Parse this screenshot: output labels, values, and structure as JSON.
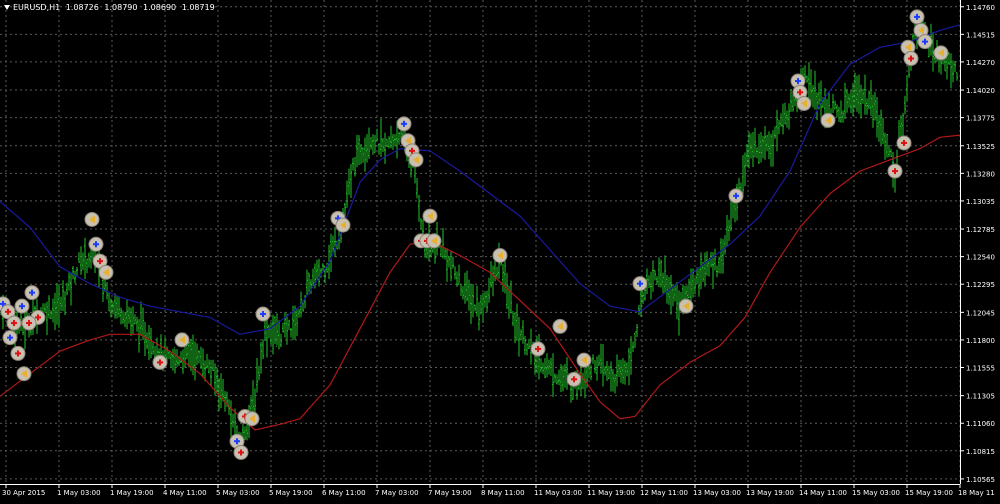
{
  "header": {
    "symbol": "EURUSD,H1",
    "open": "1.08726",
    "high": "1.08790",
    "low": "1.08690",
    "close": "1.08719"
  },
  "colors": {
    "background": "#000000",
    "grid": "#5a5a5a",
    "candle": "#22c32a",
    "ma_fast": "#1a1a9e",
    "ma_slow": "#b01818",
    "axis_text": "#ffffff",
    "signal_buy": "#1a3cff",
    "signal_sell": "#e01010",
    "signal_neutral": "#e8b030"
  },
  "chart_data": {
    "type": "line",
    "price_axis": {
      "ticks": [
        "1.14760",
        "1.14515",
        "1.14270",
        "1.14020",
        "1.13775",
        "1.13525",
        "1.13280",
        "1.13035",
        "1.12785",
        "1.12540",
        "1.12295",
        "1.12045",
        "1.11800",
        "1.11555",
        "1.11305",
        "1.11060",
        "1.10815",
        "1.10565"
      ],
      "ylim": [
        1.1052,
        1.1482
      ]
    },
    "time_axis": {
      "ticks": [
        "30 Apr 2015",
        "1 May 03:00",
        "1 May 19:00",
        "4 May 11:00",
        "5 May 03:00",
        "5 May 19:00",
        "6 May 11:00",
        "7 May 03:00",
        "7 May 19:00",
        "8 May 11:00",
        "11 May 03:00",
        "11 May 19:00",
        "12 May 11:00",
        "13 May 03:00",
        "13 May 19:00",
        "14 May 11:00",
        "15 May 03:00",
        "15 May 19:00",
        "18 May 11"
      ]
    },
    "grid": true,
    "price_path": [
      [
        0,
        1.1212
      ],
      [
        20,
        1.119
      ],
      [
        40,
        1.1205
      ],
      [
        60,
        1.121
      ],
      [
        80,
        1.125
      ],
      [
        95,
        1.1255
      ],
      [
        110,
        1.1215
      ],
      [
        130,
        1.12
      ],
      [
        150,
        1.118
      ],
      [
        170,
        1.116
      ],
      [
        190,
        1.117
      ],
      [
        210,
        1.1155
      ],
      [
        225,
        1.113
      ],
      [
        240,
        1.1085
      ],
      [
        255,
        1.113
      ],
      [
        265,
        1.119
      ],
      [
        280,
        1.1185
      ],
      [
        295,
        1.1195
      ],
      [
        310,
        1.123
      ],
      [
        325,
        1.1245
      ],
      [
        340,
        1.1275
      ],
      [
        355,
        1.134
      ],
      [
        370,
        1.136
      ],
      [
        385,
        1.135
      ],
      [
        400,
        1.1365
      ],
      [
        415,
        1.133
      ],
      [
        425,
        1.126
      ],
      [
        440,
        1.1265
      ],
      [
        460,
        1.123
      ],
      [
        480,
        1.1205
      ],
      [
        500,
        1.125
      ],
      [
        515,
        1.1195
      ],
      [
        535,
        1.1165
      ],
      [
        555,
        1.115
      ],
      [
        575,
        1.114
      ],
      [
        595,
        1.116
      ],
      [
        615,
        1.1145
      ],
      [
        630,
        1.116
      ],
      [
        645,
        1.123
      ],
      [
        660,
        1.124
      ],
      [
        680,
        1.121
      ],
      [
        700,
        1.124
      ],
      [
        720,
        1.125
      ],
      [
        735,
        1.13
      ],
      [
        750,
        1.135
      ],
      [
        770,
        1.1355
      ],
      [
        790,
        1.1385
      ],
      [
        805,
        1.142
      ],
      [
        820,
        1.139
      ],
      [
        840,
        1.138
      ],
      [
        855,
        1.14
      ],
      [
        870,
        1.139
      ],
      [
        885,
        1.136
      ],
      [
        895,
        1.133
      ],
      [
        905,
        1.139
      ],
      [
        915,
        1.146
      ],
      [
        925,
        1.145
      ],
      [
        940,
        1.143
      ],
      [
        955,
        1.142
      ]
    ],
    "series": [
      {
        "values": [
          [
            0,
            1.1303
          ],
          [
            30,
            1.128
          ],
          [
            60,
            1.1245
          ],
          [
            90,
            1.123
          ],
          [
            120,
            1.1218
          ],
          [
            150,
            1.121
          ],
          [
            180,
            1.1205
          ],
          [
            210,
            1.12
          ],
          [
            240,
            1.1185
          ],
          [
            270,
            1.119
          ],
          [
            300,
            1.121
          ],
          [
            330,
            1.125
          ],
          [
            360,
            1.132
          ],
          [
            380,
            1.134
          ],
          [
            400,
            1.135
          ],
          [
            430,
            1.1348
          ],
          [
            460,
            1.133
          ],
          [
            490,
            1.131
          ],
          [
            520,
            1.129
          ],
          [
            550,
            1.126
          ],
          [
            580,
            1.123
          ],
          [
            610,
            1.121
          ],
          [
            640,
            1.1205
          ],
          [
            670,
            1.1225
          ],
          [
            700,
            1.1245
          ],
          [
            730,
            1.1265
          ],
          [
            760,
            1.129
          ],
          [
            790,
            1.133
          ],
          [
            820,
            1.139
          ],
          [
            850,
            1.1425
          ],
          [
            880,
            1.144
          ],
          [
            910,
            1.1445
          ],
          [
            940,
            1.1455
          ],
          [
            960,
            1.146
          ]
        ]
      },
      {
        "values": [
          [
            0,
            1.113
          ],
          [
            30,
            1.115
          ],
          [
            60,
            1.117
          ],
          [
            90,
            1.118
          ],
          [
            110,
            1.1185
          ],
          [
            140,
            1.1185
          ],
          [
            170,
            1.117
          ],
          [
            200,
            1.115
          ],
          [
            230,
            1.112
          ],
          [
            255,
            1.11
          ],
          [
            280,
            1.1105
          ],
          [
            300,
            1.111
          ],
          [
            330,
            1.114
          ],
          [
            360,
            1.119
          ],
          [
            390,
            1.124
          ],
          [
            410,
            1.1265
          ],
          [
            430,
            1.1268
          ],
          [
            460,
            1.1255
          ],
          [
            490,
            1.124
          ],
          [
            520,
            1.1215
          ],
          [
            550,
            1.119
          ],
          [
            580,
            1.115
          ],
          [
            600,
            1.1125
          ],
          [
            620,
            1.111
          ],
          [
            635,
            1.1112
          ],
          [
            660,
            1.114
          ],
          [
            690,
            1.116
          ],
          [
            720,
            1.1175
          ],
          [
            745,
            1.12
          ],
          [
            770,
            1.124
          ],
          [
            800,
            1.128
          ],
          [
            830,
            1.131
          ],
          [
            860,
            1.133
          ],
          [
            890,
            1.134
          ],
          [
            920,
            1.135
          ],
          [
            940,
            1.136
          ],
          [
            960,
            1.1362
          ]
        ]
      }
    ],
    "signals": [
      [
        3,
        1.1212,
        "buy"
      ],
      [
        8,
        1.1205,
        "sell"
      ],
      [
        14,
        1.1195,
        "sell"
      ],
      [
        22,
        1.121,
        "buy"
      ],
      [
        32,
        1.1222,
        "buy"
      ],
      [
        38,
        1.12,
        "sell"
      ],
      [
        10,
        1.1182,
        "buy"
      ],
      [
        18,
        1.1168,
        "sell"
      ],
      [
        24,
        1.115,
        "neutral"
      ],
      [
        29,
        1.1195,
        "sell"
      ],
      [
        92,
        1.1287,
        "neutral"
      ],
      [
        96,
        1.1265,
        "buy"
      ],
      [
        100,
        1.125,
        "sell"
      ],
      [
        106,
        1.124,
        "neutral"
      ],
      [
        160,
        1.116,
        "sell"
      ],
      [
        182,
        1.118,
        "neutral"
      ],
      [
        237,
        1.109,
        "buy"
      ],
      [
        241,
        1.108,
        "sell"
      ],
      [
        245,
        1.1112,
        "sell"
      ],
      [
        252,
        1.111,
        "neutral"
      ],
      [
        263,
        1.1203,
        "buy"
      ],
      [
        338,
        1.1288,
        "buy"
      ],
      [
        343,
        1.1282,
        "neutral"
      ],
      [
        404,
        1.1372,
        "buy"
      ],
      [
        408,
        1.1357,
        "neutral"
      ],
      [
        412,
        1.1348,
        "sell"
      ],
      [
        416,
        1.134,
        "neutral"
      ],
      [
        430,
        1.129,
        "neutral"
      ],
      [
        421,
        1.1268,
        "sell"
      ],
      [
        427,
        1.1268,
        "sell"
      ],
      [
        434,
        1.1268,
        "neutral"
      ],
      [
        500,
        1.1255,
        "neutral"
      ],
      [
        538,
        1.1172,
        "sell"
      ],
      [
        560,
        1.1192,
        "neutral"
      ],
      [
        574,
        1.1145,
        "sell"
      ],
      [
        584,
        1.1162,
        "neutral"
      ],
      [
        640,
        1.123,
        "buy"
      ],
      [
        686,
        1.121,
        "neutral"
      ],
      [
        736,
        1.1308,
        "buy"
      ],
      [
        798,
        1.141,
        "buy"
      ],
      [
        800,
        1.14,
        "sell"
      ],
      [
        804,
        1.139,
        "neutral"
      ],
      [
        828,
        1.1375,
        "neutral"
      ],
      [
        895,
        1.133,
        "sell"
      ],
      [
        904,
        1.1355,
        "sell"
      ],
      [
        908,
        1.144,
        "neutral"
      ],
      [
        911,
        1.143,
        "sell"
      ],
      [
        917,
        1.1467,
        "buy"
      ],
      [
        921,
        1.1455,
        "neutral"
      ],
      [
        925,
        1.1445,
        "buy"
      ],
      [
        941,
        1.1435,
        "neutral"
      ]
    ]
  }
}
